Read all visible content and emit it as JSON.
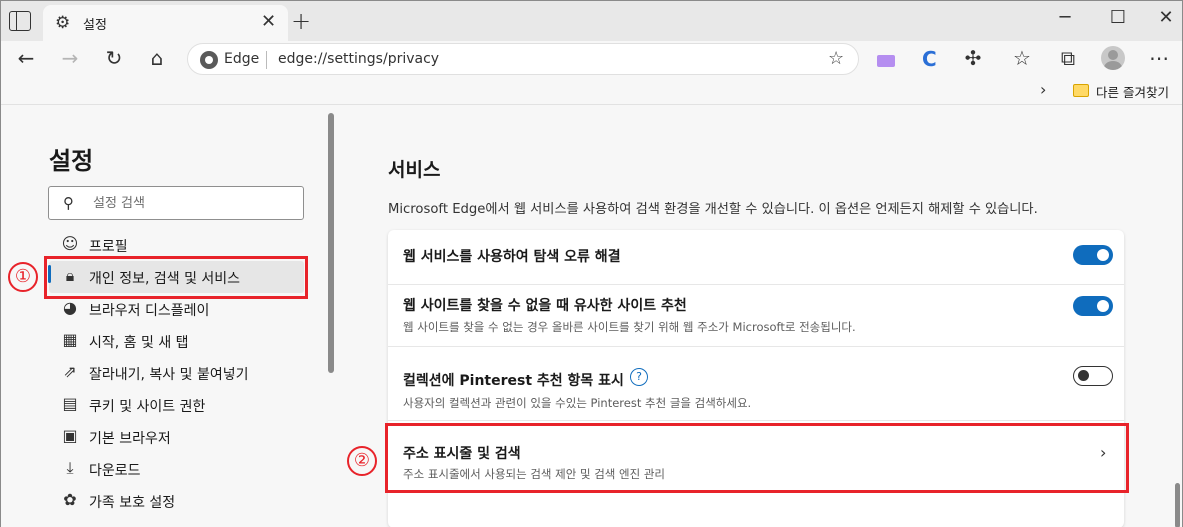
{
  "browser": {
    "tab_title": "설정",
    "omnibox_brand": "Edge",
    "url": "edge://settings/privacy",
    "favorites_folder": "다른 즐겨찾기"
  },
  "sidebar": {
    "title": "설정",
    "search_placeholder": "설정 검색",
    "items": [
      {
        "label": "프로필",
        "icon": "profile-icon"
      },
      {
        "label": "개인 정보, 검색 및 서비스",
        "icon": "lock-icon",
        "active": true
      },
      {
        "label": "브라우저 디스플레이",
        "icon": "palette-icon"
      },
      {
        "label": "시작, 홈 및 새 탭",
        "icon": "start-page-icon"
      },
      {
        "label": "잘라내기, 복사 및 붙여넣기",
        "icon": "share-icon"
      },
      {
        "label": "쿠키 및 사이트 권한",
        "icon": "site-permissions-icon"
      },
      {
        "label": "기본 브라우저",
        "icon": "default-browser-icon"
      },
      {
        "label": "다운로드",
        "icon": "download-icon"
      },
      {
        "label": "가족 보호 설정",
        "icon": "family-icon"
      }
    ]
  },
  "main": {
    "section_title": "서비스",
    "section_desc": "Microsoft Edge에서 웹 서비스를 사용하여 검색 환경을 개선할 수 있습니다. 이 옵션은 언제든지 해제할 수 있습니다.",
    "rows": [
      {
        "title": "웹 서비스를 사용하여 탐색 오류 해결",
        "subtitle": "",
        "control": "toggle",
        "enabled": true
      },
      {
        "title": "웹 사이트를 찾을 수 없을 때 유사한 사이트 추천",
        "subtitle": "웹 사이트를 찾을 수 없는 경우 올바른 사이트를 찾기 위해 웹 주소가 Microsoft로 전송됩니다.",
        "control": "toggle",
        "enabled": true
      },
      {
        "title": "컬렉션에 Pinterest 추천 항목 표시",
        "subtitle": "사용자의 컬렉션과 관련이 있을 수있는 Pinterest 추천 글을 검색하세요.",
        "control": "toggle",
        "enabled": false
      },
      {
        "title": "주소 표시줄 및 검색",
        "subtitle": "주소 표시줄에서 사용되는 검색 제안 및 검색 엔진 관리",
        "control": "link"
      }
    ]
  },
  "annotations": {
    "marker1": "①",
    "marker2": "②",
    "color": "#e8232a"
  },
  "colors": {
    "accent": "#0f6cbd"
  }
}
